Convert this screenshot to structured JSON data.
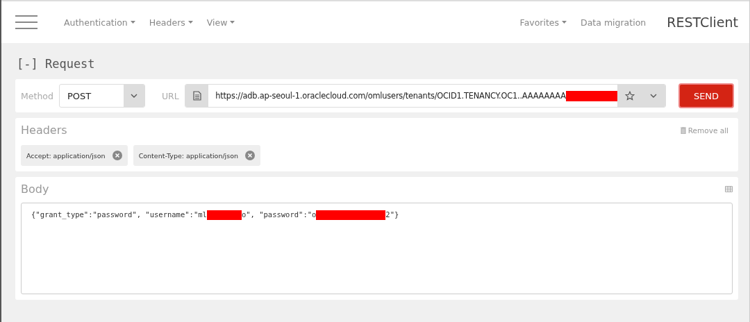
{
  "navbar": {
    "menus": [
      {
        "label": "Authentication",
        "dropdown": true
      },
      {
        "label": "Headers",
        "dropdown": true
      },
      {
        "label": "View",
        "dropdown": true
      }
    ],
    "right_menus": [
      {
        "label": "Favorites",
        "dropdown": true
      },
      {
        "label": "Data migration",
        "dropdown": false
      }
    ],
    "brand": "RESTClient"
  },
  "section_title": "[-] Request",
  "request": {
    "method_label": "Method",
    "method": "POST",
    "url_label": "URL",
    "url": [
      {
        "kind": "text",
        "text": "https://adb.ap-seoul-1.oraclecloud.com/omlusers/tenants/OCID1.TENANCY.OC1..AAAAAAAA"
      },
      {
        "kind": "redaction"
      }
    ],
    "send": "SEND"
  },
  "headers": {
    "title": "Headers",
    "remove_all": "Remove all",
    "items": [
      {
        "label": "Accept: application/json"
      },
      {
        "label": "Content-Type: application/json"
      }
    ]
  },
  "body": {
    "title": "Body",
    "content": [
      {
        "kind": "text",
        "text": "{\"grant_type\":\"password\", \"username\":\"ml"
      },
      {
        "kind": "redaction"
      },
      {
        "kind": "text",
        "text": "o\", \"password\":\"o"
      },
      {
        "kind": "redaction"
      },
      {
        "kind": "text",
        "text": "2\"}"
      }
    ]
  }
}
